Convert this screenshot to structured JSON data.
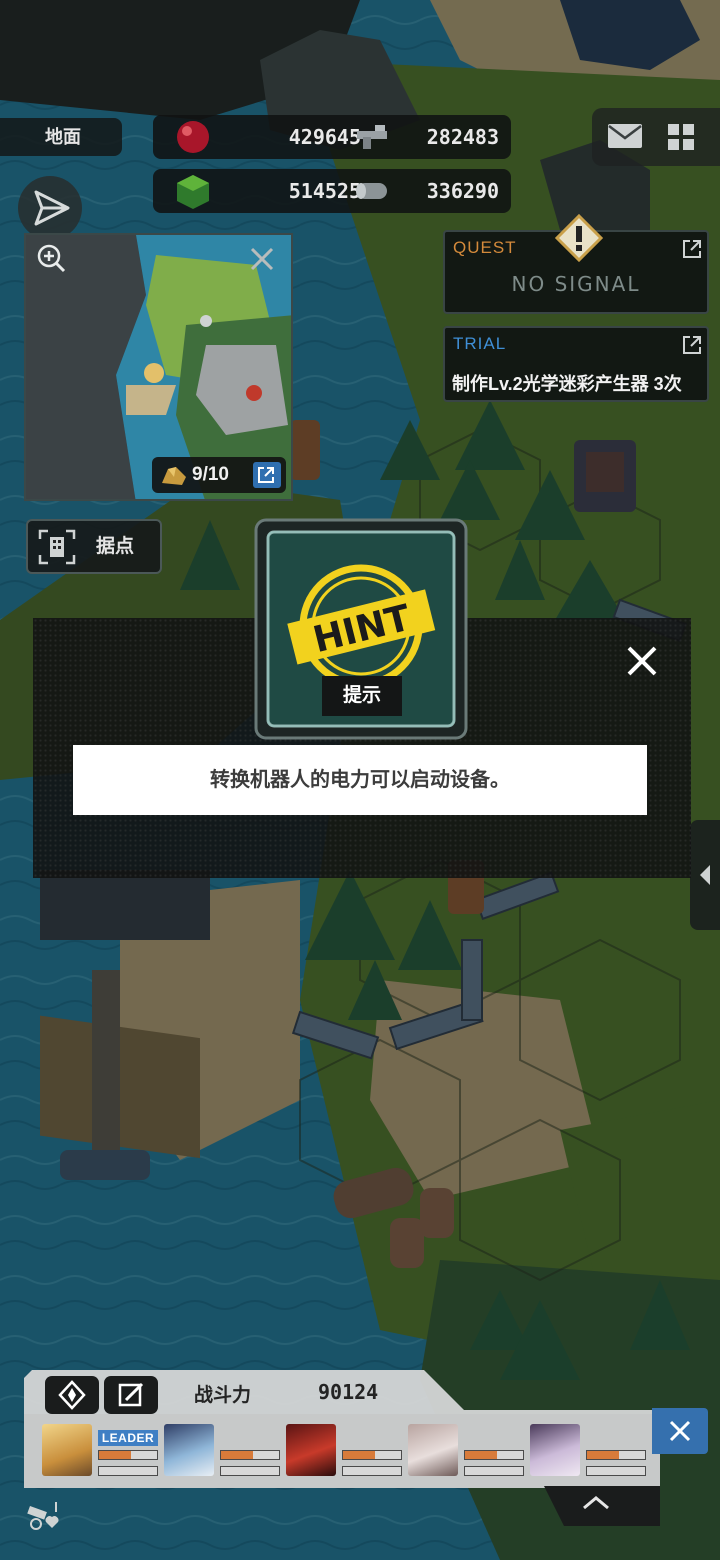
{
  "terrain": {
    "label": "地面"
  },
  "resources": [
    {
      "icon": "red-orb-icon",
      "value": "429645"
    },
    {
      "icon": "gun-parts-icon",
      "value": "282483"
    },
    {
      "icon": "green-cube-icon",
      "value": "514525"
    },
    {
      "icon": "cylinder-battery-icon",
      "value": "336290"
    }
  ],
  "minimap": {
    "count": "9/10"
  },
  "stronghold": {
    "label": "据点"
  },
  "quest": {
    "title": "QUEST",
    "status": "NO SIGNAL"
  },
  "trial": {
    "title": "TRIAL",
    "description": "制作Lv.2光学迷彩产生器 3次"
  },
  "hint": {
    "badge_text": "HINT",
    "title": "提示",
    "message": "转换机器人的电力可以启动设备。"
  },
  "team": {
    "power_label": "战斗力",
    "power_value": "90124",
    "leader_badge": "LEADER",
    "members": [
      {
        "name": "member-1",
        "leader": true,
        "hp": 0.55
      },
      {
        "name": "member-2",
        "leader": false,
        "hp": 0.55
      },
      {
        "name": "member-3",
        "leader": false,
        "hp": 0.55
      },
      {
        "name": "member-4",
        "leader": false,
        "hp": 0.55
      },
      {
        "name": "member-5",
        "leader": false,
        "hp": 0.55
      }
    ]
  },
  "colors": {
    "quest": "#d48a3b",
    "trial": "#3f8fd6",
    "accent_blue": "#3570ae",
    "hint_yellow": "#f2d21e"
  }
}
